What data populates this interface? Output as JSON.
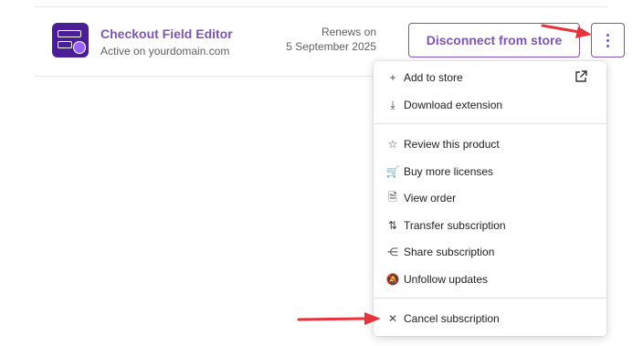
{
  "product": {
    "title": "Checkout Field Editor",
    "subtitle": "Active on yourdomain.com",
    "icon": "checkout-field-editor-icon",
    "brand_color": "#4a1f96"
  },
  "renewal": {
    "label": "Renews on",
    "date": "5 September 2025"
  },
  "actions": {
    "disconnect_label": "Disconnect from store",
    "more_icon": "kebab-menu-icon",
    "accent_color": "#7f54b3"
  },
  "menu": {
    "external_link_icon": "external-link-icon",
    "items": [
      {
        "label": "Add to store",
        "icon": "plus-icon",
        "glyph": "+"
      },
      {
        "label": "Download extension",
        "icon": "download-icon",
        "glyph": "⤓"
      },
      {
        "label": "Review this product",
        "icon": "star-icon",
        "glyph": "☆"
      },
      {
        "label": "Buy more licenses",
        "icon": "cart-icon",
        "glyph": "🛒"
      },
      {
        "label": "View order",
        "icon": "document-icon",
        "glyph": "🗎"
      },
      {
        "label": "Transfer subscription",
        "icon": "transfer-icon",
        "glyph": "⇅"
      },
      {
        "label": "Share subscription",
        "icon": "share-icon",
        "glyph": "⋲"
      },
      {
        "label": "Unfollow updates",
        "icon": "bell-off-icon",
        "glyph": "🔕"
      },
      {
        "label": "Cancel subscription",
        "icon": "close-icon",
        "glyph": "✕"
      }
    ]
  },
  "annotation_color": "#e8323c"
}
